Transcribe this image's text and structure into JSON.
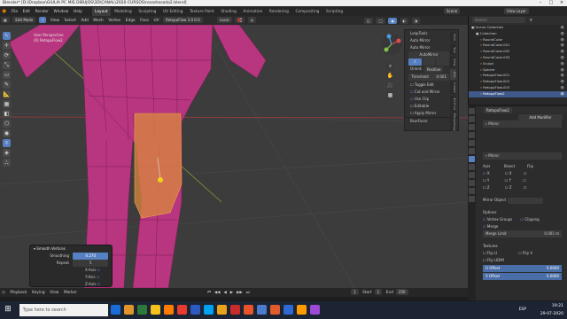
{
  "titlebar": {
    "text": "Blender* [D:\\Dropbox\\GIULIA PC MIS DIBUJOS\\3D\\CANAL\\2020 CURSOS\\rosadrosada2.blend]",
    "win_controls": [
      "–",
      "□",
      "×"
    ]
  },
  "menubar": {
    "items": [
      "File",
      "Edit",
      "Render",
      "Window",
      "Help"
    ],
    "workspaces": [
      "Layout",
      "Modeling",
      "Sculpting",
      "UV Editing",
      "Texture Paint",
      "Shading",
      "Animation",
      "Rendering",
      "Compositing",
      "Scripting"
    ],
    "active_workspace": "Layout",
    "scene": "Scene",
    "view_layer": "View Layer"
  },
  "viewport_header": {
    "mode": "Edit Mode",
    "menus": [
      "View",
      "Select",
      "Add",
      "Mesh",
      "Vertex",
      "Edge",
      "Face",
      "UV"
    ],
    "object": "RetopoFlow 3.0 0.0",
    "orientation": "Local",
    "transform": "Global",
    "options": "Options"
  },
  "viewport": {
    "perspective": "User Perspective",
    "object_name": "(0) RetopoFlow2",
    "tools": [
      "↖",
      "✛",
      "⟳",
      "⤡",
      "▭",
      "✎",
      "📐",
      "▦",
      "◧",
      "⬡",
      "◉",
      "⌾",
      "◈",
      "⛬"
    ]
  },
  "npanel": {
    "rows": [
      "LoopTools",
      "Auto Mirror",
      "Auto Mirror",
      "AutoMirror",
      "X",
      "Orient.",
      "Positive",
      "Threshold",
      "0.001",
      "Toggle Edit",
      "Cut and Mirror",
      "Use Clip",
      "Editable",
      "Apply Mirror",
      "Bsurfaces"
    ],
    "tabs": [
      "Item",
      "Tool",
      "View",
      "Edit",
      "Create",
      "3D-Print",
      "Retopology"
    ]
  },
  "redo_panel": {
    "title": "Smooth Vertices",
    "smoothing_label": "Smoothing",
    "smoothing_value": "0.270",
    "repeat_label": "Repeat",
    "repeat_value": "5",
    "axes": [
      "X-Axis",
      "Y-Axis",
      "Z-Axis"
    ]
  },
  "timeline": {
    "items": [
      "Playback",
      "Keying",
      "View",
      "Marker"
    ],
    "frame": "1",
    "start_label": "Start",
    "start": "1",
    "end_label": "End",
    "end": "250"
  },
  "outliner": {
    "title": "Scene Collection",
    "search_placeholder": "Search",
    "rows": [
      "Scene Collection",
      "Collection",
      "RoundCube",
      "RoundCube.001",
      "RoundCube.002",
      "RoundCube.003",
      "Sculpt",
      "Sphere",
      "RetopoFlow.001",
      "RetopoFlow.002",
      "RetopoFlow.003",
      "RetopoFlow2"
    ],
    "selected_index": 11
  },
  "properties": {
    "object_name": "RetopoFlow2",
    "add_modifier": "Add Modifier",
    "modifier_name": "Mirror",
    "axis_label": "Axis",
    "bisect_label": "Bisect",
    "flip_label": "Flip",
    "axes": [
      "X",
      "Y",
      "Z"
    ],
    "mirror_object_label": "Mirror Object",
    "options_label": "Options",
    "vertex_groups": "Vertex Groups",
    "clipping": "Clipping",
    "merge": "Merge",
    "merge_limit_label": "Merge Limit",
    "merge_limit": "0.001 m",
    "textures_label": "Textures",
    "flip_u": "Flip U",
    "flip_v": "Flip V",
    "flip_udim": "Flip UDIM",
    "u_offset": "U Offset",
    "u_offset_value": "0.0000",
    "v_offset": "V Offset",
    "v_offset_value": "0.0000"
  },
  "taskbar": {
    "search_placeholder": "Type here to search",
    "time": "19:21",
    "date": "29-07-2020",
    "lang": "ESP",
    "app_colors": [
      "#1a6dd6",
      "#e0952a",
      "#2b7a3c",
      "#f4c21b",
      "#ff7c00",
      "#e63b2e",
      "#2d5ac0",
      "#00a1f1",
      "#e9a219",
      "#c92b2b",
      "#e8542a",
      "#4c7acc",
      "#e25c2b",
      "#2e6ad2",
      "#ff9a00",
      "#9d4ad5"
    ]
  },
  "colors": {
    "mesh": "#b8357f",
    "selected": "#d9893d",
    "active_blue": "#5680c2",
    "highlight_row": "#3f5a8a"
  }
}
